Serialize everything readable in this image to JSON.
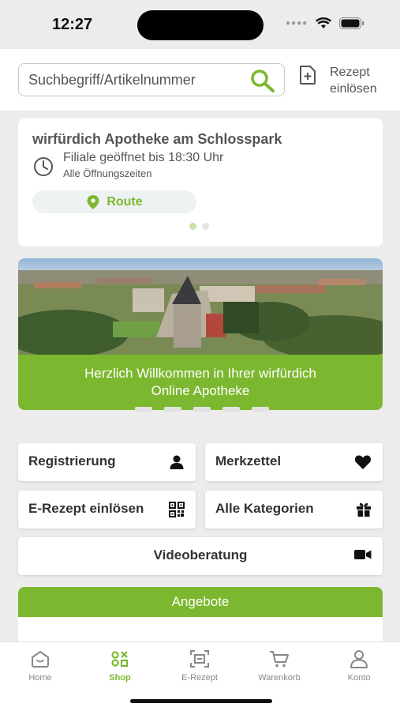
{
  "status_bar": {
    "time": "12:27"
  },
  "header": {
    "search_placeholder": "Suchbegriff/Artikelnummer",
    "rezept_line1": "Rezept",
    "rezept_line2": "einlösen"
  },
  "store": {
    "name": "wirfürdich Apotheke am Schlosspark",
    "open_text": "Filiale geöffnet bis 18:30 Uhr",
    "hours_link": "Alle Öffnungszeiten",
    "route_label": "Route",
    "page_index": 1,
    "page_count": 2
  },
  "banner": {
    "caption_line1": "Herzlich Willkommen in Ihrer wirfürdich",
    "caption_line2": "Online Apotheke",
    "slide_count": 5
  },
  "tiles": {
    "registrierung": {
      "label": "Registrierung",
      "icon": "person-icon"
    },
    "merkzettel": {
      "label": "Merkzettel",
      "icon": "heart-icon"
    },
    "erezept": {
      "label": "E-Rezept einlösen",
      "icon": "qr-code-icon"
    },
    "kategorien": {
      "label": "Alle Kategorien",
      "icon": "gift-icon"
    },
    "video": {
      "label": "Videoberatung",
      "icon": "video-camera-icon"
    }
  },
  "offers": {
    "title": "Angebote"
  },
  "tabbar": {
    "items": [
      {
        "label": "Home",
        "icon": "home-icon"
      },
      {
        "label": "Shop",
        "icon": "shop-icon"
      },
      {
        "label": "E-Rezept",
        "icon": "scan-icon"
      },
      {
        "label": "Warenkorb",
        "icon": "cart-icon"
      },
      {
        "label": "Konto",
        "icon": "account-icon"
      }
    ],
    "active_index": 1
  },
  "colors": {
    "accent": "#7cb82f",
    "background": "#ececec",
    "text": "#333333"
  }
}
